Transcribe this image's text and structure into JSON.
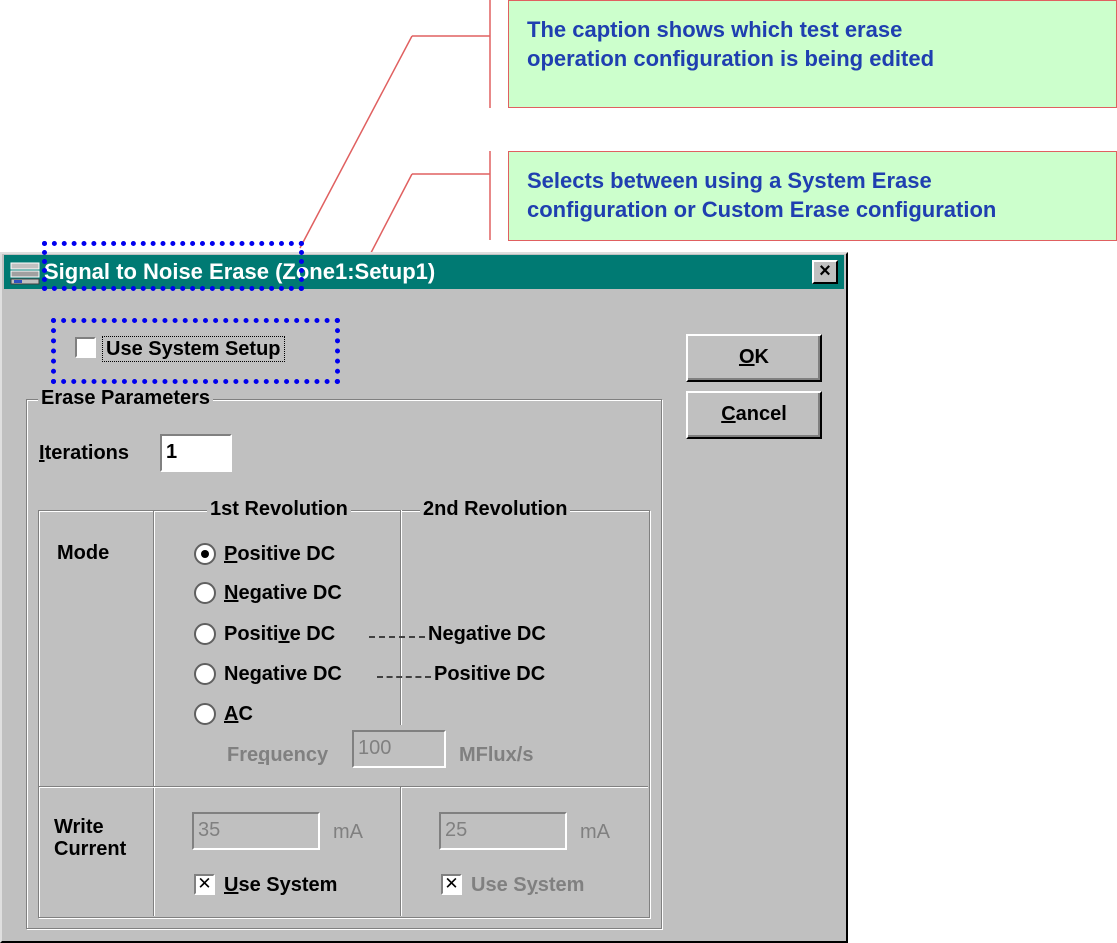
{
  "callouts": [
    {
      "lines": [
        "The caption shows which test erase",
        "operation configuration is being edited"
      ]
    },
    {
      "lines": [
        "Selects between using a System Erase",
        "configuration or Custom Erase configuration"
      ]
    }
  ],
  "dialog": {
    "title": "Signal to Noise Erase (Zone1:Setup1)",
    "close_label": "×",
    "use_system_setup": {
      "label": "Use System Setup",
      "checked": false
    },
    "buttons": {
      "ok": "OK",
      "cancel": "Cancel"
    },
    "erase_parameters": {
      "group_label": "Erase Parameters",
      "iterations_label": "Iterations",
      "iterations_value": "1",
      "first_revolution": "1st Revolution",
      "second_revolution": "2nd Revolution",
      "mode_label": "Mode",
      "modes": {
        "m1": {
          "prefix": "",
          "u": "P",
          "rest": "ositive DC",
          "selected": true
        },
        "m2": {
          "prefix": "",
          "u": "N",
          "rest": "egative DC",
          "selected": false
        },
        "m3": {
          "prefix": "Positi",
          "u": "v",
          "rest": "e DC",
          "second": "Negative DC",
          "selected": false
        },
        "m4": {
          "prefix": "Ne",
          "u": "g",
          "rest": "ative DC",
          "second": "Positive DC",
          "selected": false
        },
        "m5": {
          "prefix": "",
          "u": "A",
          "rest": "C",
          "selected": false
        }
      },
      "frequency": {
        "prefix": "Fre",
        "u": "q",
        "rest": "uency",
        "value": "100",
        "unit": "MFlux/s"
      },
      "write_current_line1": "Write",
      "write_current_line2": "Current",
      "current_1": {
        "value": "35",
        "unit": "mA",
        "use_system_label": "Use System",
        "use_system_checked": true
      },
      "current_2": {
        "value": "25",
        "unit": "mA",
        "use_system_label": "Use System",
        "use_system_checked": true
      }
    }
  }
}
